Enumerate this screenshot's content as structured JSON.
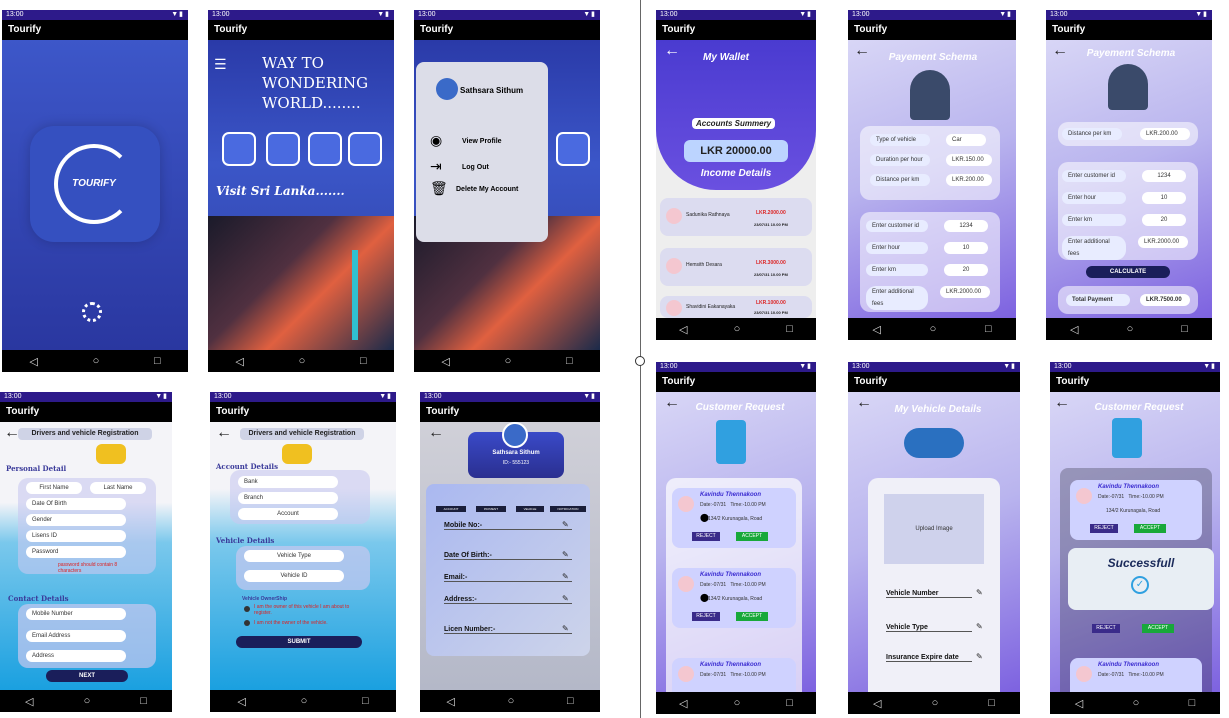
{
  "app_name": "Tourify",
  "time": "13:00",
  "nav": {
    "back": "◁",
    "home": "○",
    "recent": "□"
  },
  "splash": {
    "logo_text": "TOURIFY"
  },
  "home": {
    "headline": [
      "WAY TO",
      "WONDERING",
      "WORLD........"
    ],
    "tagline": "Visit Sri Lanka......."
  },
  "menu": {
    "user": "Sathsara Sithum",
    "items": [
      "View Profile",
      "Log Out",
      "Delete My Account"
    ]
  },
  "wallet": {
    "title": "My Wallet",
    "summary_label": "Accounts Summery",
    "amount": "LKR 20000.00",
    "income_title": "Income Details",
    "rows": [
      {
        "name": "Sadunika Rathnaya",
        "amount": "LKR.2000.00",
        "date": "23/07/31 10.00 PM"
      },
      {
        "name": "Hemsith Desara",
        "amount": "LKR.3000.00",
        "date": "23/07/31 10.00 PM"
      },
      {
        "name": "Shavidini Eakanayaka",
        "amount": "LKR.1000.00",
        "date": "23/07/31 10.00 PM"
      }
    ]
  },
  "pay1": {
    "title": "Payement Schema",
    "vehicle": [
      {
        "label": "Type of vehicle",
        "value": "Car"
      },
      {
        "label": "Duration per hour",
        "value": "LKR.150.00"
      },
      {
        "label": "Distance per km",
        "value": "LKR.200.00"
      }
    ],
    "calc": [
      {
        "label": "Enter customer id",
        "value": "1234"
      },
      {
        "label": "Enter hour",
        "value": "10"
      },
      {
        "label": "Enter km",
        "value": "20"
      },
      {
        "label": "Enter additional fees",
        "value": "LKR.2000.00"
      }
    ]
  },
  "pay2": {
    "title": "Payement Schema",
    "distance_label": "Distance per km",
    "distance_value": "LKR.200.00",
    "calc": [
      {
        "label": "Enter customer id",
        "value": "1234"
      },
      {
        "label": "Enter hour",
        "value": "10"
      },
      {
        "label": "Enter km",
        "value": "20"
      },
      {
        "label": "Enter additional fees",
        "value": "LKR.2000.00"
      }
    ],
    "calculate": "CALCULATE",
    "total_label": "Total Payment",
    "total_value": "LKR.7500.00"
  },
  "reg1": {
    "title": "Drivers and vehicle Registration",
    "personal": "Personal Detail",
    "first": "First Name",
    "last": "Last Name",
    "dob": "Date Of Birth",
    "gender": "Gender",
    "license": "Lisens ID",
    "password": "Password",
    "pw_hint": "password should contain 8 characters",
    "contact": "Contact Details",
    "mobile": "Mobile Number",
    "email": "Email Address",
    "address": "Address",
    "next": "NEXT"
  },
  "reg2": {
    "title": "Drivers and vehicle Registration",
    "account": "Account Details",
    "bank": "Bank",
    "branch": "Branch",
    "acc": "Account",
    "vehicle": "Vehicle Details",
    "vtype": "Vehicle Type",
    "vid": "Vehicle ID",
    "ownership": "Vehicle OwnerShip",
    "own_yes": "I am the owner of this vehicle I am about to register.",
    "own_no": "I am not the owner of the vehicle.",
    "submit": "SUBMIT"
  },
  "profile": {
    "name": "Sathsara Sithum",
    "id": "ID:- 555123",
    "tabs": [
      "ACCOUNT",
      "PAYMENT",
      "VEHICLE",
      "NOTIFICATION"
    ],
    "fields": [
      "Mobile No:-",
      "Date Of Birth:-",
      "Email:-",
      "Address:-",
      "Licen Number:-"
    ]
  },
  "request": {
    "title": "Customer Request",
    "items": [
      {
        "name": "Kavindu Thennakoon",
        "date": "Date:-07/31",
        "time": "Time:-10.00 PM",
        "addr": "134/2 Kurunagala, Road"
      },
      {
        "name": "Kavindu Thennakoon",
        "date": "Date:-07/31",
        "time": "Time:-10.00 PM",
        "addr": "134/2 Kurunagala, Road"
      },
      {
        "name": "Kavindu Thennakoon",
        "date": "Date:-07/31",
        "time": "Time:-10.00 PM",
        "addr": ""
      }
    ],
    "reject": "REJECT",
    "accept": "ACCEPT"
  },
  "vehicle": {
    "title": "My Vehicle Details",
    "upload": "Upload Image",
    "fields": [
      "Vehicle Number",
      "Vehicle Type",
      "Insurance Expire date"
    ]
  },
  "success": {
    "title": "Customer Request",
    "message": "Successfull",
    "items": [
      {
        "name": "Kavindu Thennakoon",
        "date": "Date:-07/31",
        "time": "Time:-10.00 PM",
        "addr": "134/2 Kurunagala, Road"
      },
      {
        "name": "Kavindu Thennakoon",
        "date": "Date:-07/31",
        "time": "Time:-10.00 PM",
        "addr": ""
      }
    ]
  }
}
